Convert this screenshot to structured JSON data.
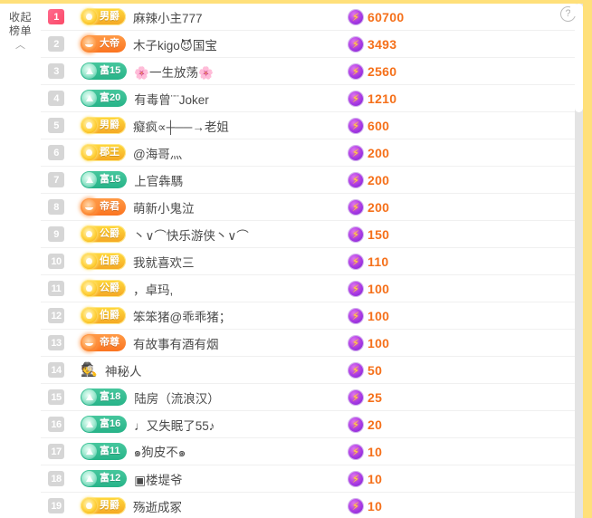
{
  "panel": {
    "collapse_label": "收起榜单",
    "collapse_chevron": "︿",
    "help_icon": "?"
  },
  "colors": {
    "rank_top": "#fb4a67",
    "rank_default": "#d6d6d6",
    "score_text": "#f5701a",
    "noble_gold": "#f5a623",
    "wealth_green": "#27b388",
    "emperor_orange": "#fb7420",
    "frame": "#ffe07a"
  },
  "rows": [
    {
      "rank": "1",
      "badge_type": "gold",
      "badge_label": "男爵",
      "name": "麻辣小主777",
      "score": "60700",
      "bolt": "⚡"
    },
    {
      "rank": "2",
      "badge_type": "orange",
      "badge_label": "大帝",
      "name": "木子kigo😈国宝",
      "score": "3493",
      "bolt": "⚡"
    },
    {
      "rank": "3",
      "badge_type": "green",
      "badge_label": "富15",
      "name": "🌸一生放荡🌸",
      "score": "2560",
      "bolt": "⚡"
    },
    {
      "rank": "4",
      "badge_type": "green",
      "badge_label": "富20",
      "name": "有毒曾¨¨Joker",
      "score": "1210",
      "bolt": "⚡"
    },
    {
      "rank": "5",
      "badge_type": "gold",
      "badge_label": "男爵",
      "name": "癡疯∝┼──→老姐",
      "score": "600",
      "bolt": "⚡"
    },
    {
      "rank": "6",
      "badge_type": "gold",
      "badge_label": "郡王",
      "name": "@海哥灬",
      "score": "200",
      "bolt": "⚡"
    },
    {
      "rank": "7",
      "badge_type": "green",
      "badge_label": "富15",
      "name": "上官犇騳",
      "score": "200",
      "bolt": "⚡"
    },
    {
      "rank": "8",
      "badge_type": "orange",
      "badge_label": "帝君",
      "name": "萌新小鬼泣",
      "score": "200",
      "bolt": "⚡"
    },
    {
      "rank": "9",
      "badge_type": "gold",
      "badge_label": "公爵",
      "name": "丶∨⌒快乐游侠丶∨⌒",
      "score": "150",
      "bolt": "⚡"
    },
    {
      "rank": "10",
      "badge_type": "gold",
      "badge_label": "伯爵",
      "name": "我就喜欢三",
      "score": "110",
      "bolt": "⚡"
    },
    {
      "rank": "11",
      "badge_type": "gold",
      "badge_label": "公爵",
      "name": "，卓玛,",
      "score": "100",
      "bolt": "⚡"
    },
    {
      "rank": "12",
      "badge_type": "gold",
      "badge_label": "伯爵",
      "name": "笨笨猪@乖乖猪；",
      "score": "100",
      "bolt": "⚡"
    },
    {
      "rank": "13",
      "badge_type": "orange",
      "badge_label": "帝尊",
      "name": "有故事有酒有烟",
      "score": "100",
      "bolt": "⚡"
    },
    {
      "rank": "14",
      "badge_type": "mystery",
      "badge_label": "🕵",
      "name": "神秘人",
      "score": "50",
      "bolt": "⚡"
    },
    {
      "rank": "15",
      "badge_type": "green",
      "badge_label": "富18",
      "name": "陆房（流浪汉）",
      "score": "25",
      "bolt": "⚡"
    },
    {
      "rank": "16",
      "badge_type": "green",
      "badge_label": "富16",
      "name": "♩又失眠了55♪",
      "score": "20",
      "bolt": "⚡"
    },
    {
      "rank": "17",
      "badge_type": "green",
      "badge_label": "富11",
      "name": "๑狗皮不๑",
      "score": "10",
      "bolt": "⚡"
    },
    {
      "rank": "18",
      "badge_type": "green",
      "badge_label": "富12",
      "name": "▣楼堤爷",
      "score": "10",
      "bolt": "⚡"
    },
    {
      "rank": "19",
      "badge_type": "gold",
      "badge_label": "男爵",
      "name": "殇逝成冢",
      "score": "10",
      "bolt": "⚡"
    }
  ]
}
